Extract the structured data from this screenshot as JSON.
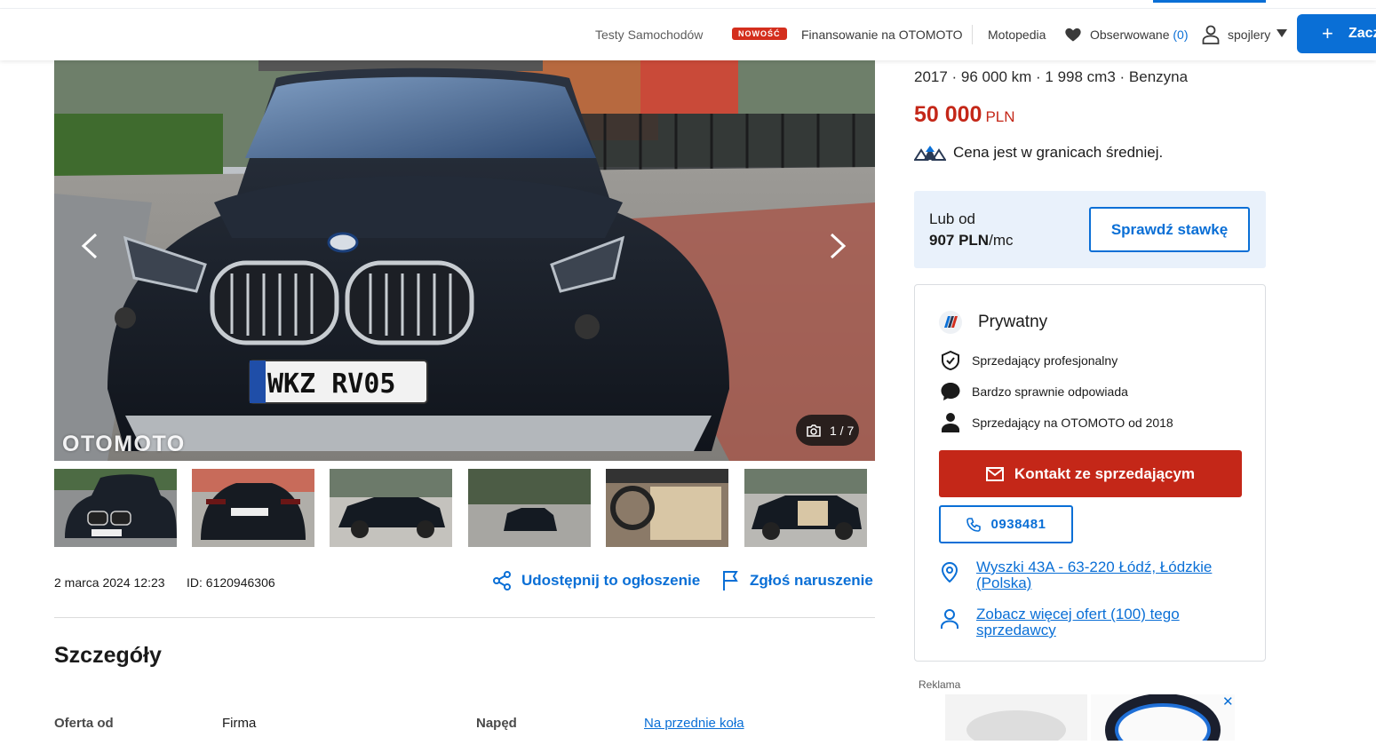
{
  "nav": {
    "testy": "Testy Samochodów",
    "badge": "NOWOŚĆ",
    "finansowanie": "Finansowanie na OTOMOTO",
    "motopedia": "Motopedia",
    "obserwowane": "Obserwowane",
    "obserwowane_count": "(0)",
    "user": "spojlery",
    "cta": "Zacz"
  },
  "gallery": {
    "watermark": "OTOMOTO",
    "counter": "1 / 7",
    "thumb_count": 6
  },
  "meta": {
    "date": "2 marca 2024 12:23",
    "id": "ID: 6120946306",
    "share": "Udostępnij to ogłoszenie",
    "report": "Zgłoś naruszenie"
  },
  "details": {
    "title": "Szczegóły",
    "row1": {
      "label1": "Oferta od",
      "value1": "Firma",
      "label2": "Napęd",
      "value2": "Na przednie koła"
    }
  },
  "listing": {
    "summary": "2017 · 96 000 km · 1 998 cm3 · Benzyna",
    "price": "50 000",
    "currency": "PLN",
    "price_eval": "Cena jest w granicach średniej."
  },
  "finance": {
    "label": "Lub od",
    "amount": "907 PLN",
    "per": "/mc",
    "button": "Sprawdź stawkę"
  },
  "seller": {
    "type": "Prywatny",
    "features": [
      "Sprzedający profesjonalny",
      "Bardzo sprawnie odpowiada",
      "Sprzedający na OTOMOTO od 2018"
    ],
    "contact_button": "Kontakt ze sprzedającym",
    "phone": "0938481",
    "location": "Wyszki 43A - 63-220 Łódź, Łódzkie (Polska)",
    "more_offers": "Zobacz więcej ofert (100) tego sprzedawcy"
  },
  "ad": {
    "label": "Reklama",
    "close": "✕"
  },
  "colors": {
    "brand_blue": "#0a6fd6",
    "price_red": "#c42718",
    "finance_bg": "#e9f1fb"
  }
}
